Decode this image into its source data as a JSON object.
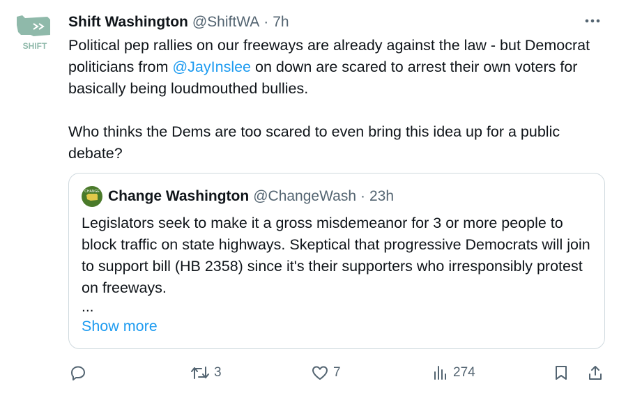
{
  "tweet": {
    "avatar_label": "SHIFT",
    "author_name": "Shift Washington",
    "handle": "@ShiftWA",
    "separator": "·",
    "time": "7h",
    "more_icon": "more-dots-icon",
    "text_part1": "Political pep rallies on our freeways are already against the law - but Democrat politicians from ",
    "mention": "@JayInslee",
    "text_part2": " on down are scared to arrest their own voters for basically being loudmouthed bullies.",
    "text_para2": "Who thinks the Dems are too scared to even bring this idea up for a public debate?"
  },
  "quote": {
    "author_name": "Change Washington",
    "handle": "@ChangeWash",
    "separator": "·",
    "time": "23h",
    "text": "Legislators seek to make it a gross misdemeanor for 3 or more people to block traffic on state highways. Skeptical that progressive Democrats will join to support bill (HB 2358) since it's their supporters who irresponsibly protest on freeways.",
    "ellipsis": "...",
    "show_more": "Show more"
  },
  "actions": {
    "reply_icon": "reply-icon",
    "reply_count": "",
    "retweet_icon": "retweet-icon",
    "retweet_count": "3",
    "like_icon": "heart-icon",
    "like_count": "7",
    "views_icon": "views-icon",
    "views_count": "274",
    "bookmark_icon": "bookmark-icon",
    "share_icon": "share-icon"
  },
  "colors": {
    "accent": "#1d9bf0",
    "text": "#0f1419",
    "secondary": "#536471",
    "border": "#cfd9de",
    "shift_logo": "#8fb9aa",
    "change_logo": "#4a7a2a"
  }
}
